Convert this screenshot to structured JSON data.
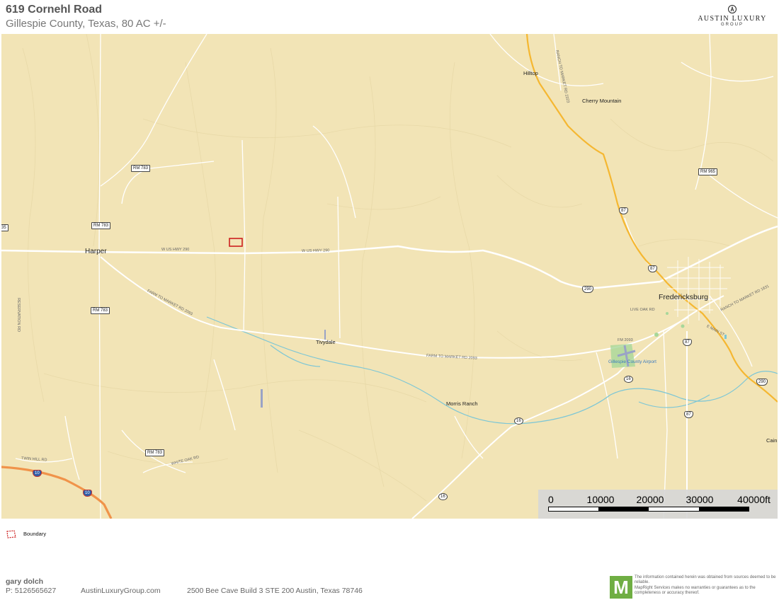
{
  "header": {
    "title": "619 Cornehl Road",
    "subtitle": "Gillespie County, Texas, 80 AC +/-",
    "brand_name": "AUSTIN LUXURY",
    "brand_group": "GROUP"
  },
  "map": {
    "places": {
      "harper": "Harper",
      "tivydale": "Tivydale",
      "fredericksburg": "Fredericksburg",
      "hilltop": "Hilltop",
      "cherry_mountain": "Cherry Mountain",
      "morris_ranch": "Morris Ranch",
      "cain": "Cain",
      "airport": "Gillespie County Airport"
    },
    "shields": {
      "rm783_a": "RM 783",
      "rm783_b": "RM 783",
      "rm783_c": "RM 783",
      "rm783_d": "RM 783",
      "rm965": "RM 965",
      "us87_a": "87",
      "us87_b": "87",
      "us87_c": "87",
      "us87_d": "87",
      "us290_a": "290",
      "us290_b": "290",
      "sh16_a": "16",
      "sh16_b": "16",
      "sh16_c": "16",
      "i10_a": "10",
      "i10_b": "10",
      "left_edge": "35"
    },
    "road_labels": {
      "hwy290_west": "W US HWY 290",
      "hwy290_mid": "W US HWY 290",
      "fm2093_west": "FARM TO MARKET RD 2093",
      "fm2093_east": "FARM TO MARKET RD 2093",
      "fm2093_short": "FM 2093",
      "rm2323": "RANCH TO MARKET RD 2323",
      "rm1631": "RANCH TO MARKET RD 1631",
      "e_main": "E MAIN ST",
      "live_oak": "LIVE OAK RD",
      "reservation": "RESERVATION RD",
      "twin_hill": "TWIN HILL RD",
      "white_oak": "WHITE OAK RD"
    }
  },
  "scale": {
    "ticks": [
      "0",
      "10000",
      "20000",
      "30000",
      "40000ft"
    ]
  },
  "legend": {
    "boundary_label": "Boundary",
    "boundary_color": "#cc1f1f"
  },
  "footer": {
    "agent_name": "gary dolch",
    "phone": "P: 5126565627",
    "website": "AustinLuxuryGroup.com",
    "address": "2500 Bee Cave Build 3 STE 200 Austin, Texas 78746",
    "logo_letter": "M",
    "disclaimer_1": "The information contained herein was obtained from sources deemed to be reliable.",
    "disclaimer_2": "MapRight Services makes no warranties or guarantees as to the completeness or accuracy thereof."
  },
  "colors": {
    "land": "#f2e4b6",
    "major_road": "#f5b731",
    "interstate": "#f0934a",
    "minor_road": "#ffffff",
    "water": "#7cc6d6",
    "boundary": "#cc1f1f",
    "logo": "#6fae43"
  }
}
